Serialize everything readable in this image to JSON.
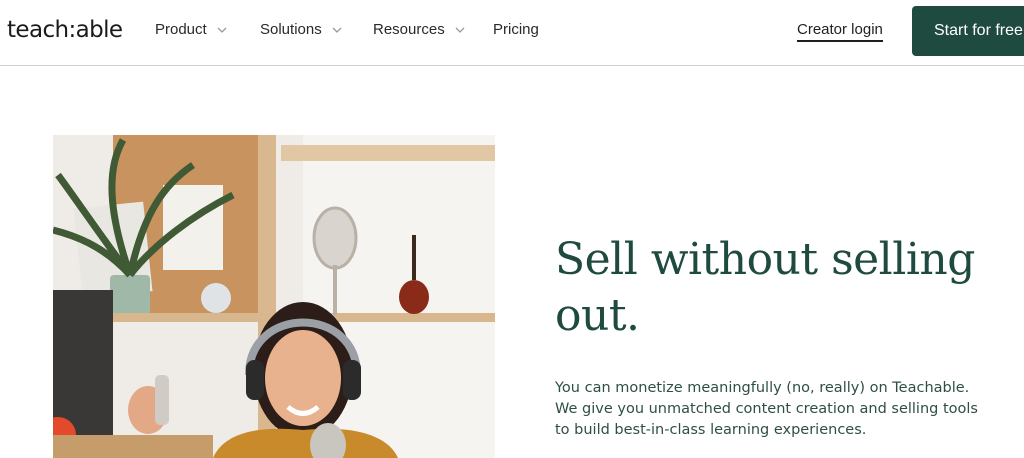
{
  "nav": {
    "logo": "teach:able",
    "items": [
      {
        "label": "Product",
        "has_dropdown": true
      },
      {
        "label": "Solutions",
        "has_dropdown": true
      },
      {
        "label": "Resources",
        "has_dropdown": true
      },
      {
        "label": "Pricing",
        "has_dropdown": false
      }
    ],
    "creator_login": "Creator login",
    "cta": "Start for free"
  },
  "hero": {
    "headline": "Sell without selling out.",
    "body": "You can monetize meaningfully (no, really) on Teachable. We give you unmatched content creation and selling tools to build best-in-class learning experiences.",
    "image_icon": "woman-with-headphones-photo"
  },
  "colors": {
    "brand_green": "#1f4a3f",
    "text_dark": "#1f1f1f"
  }
}
